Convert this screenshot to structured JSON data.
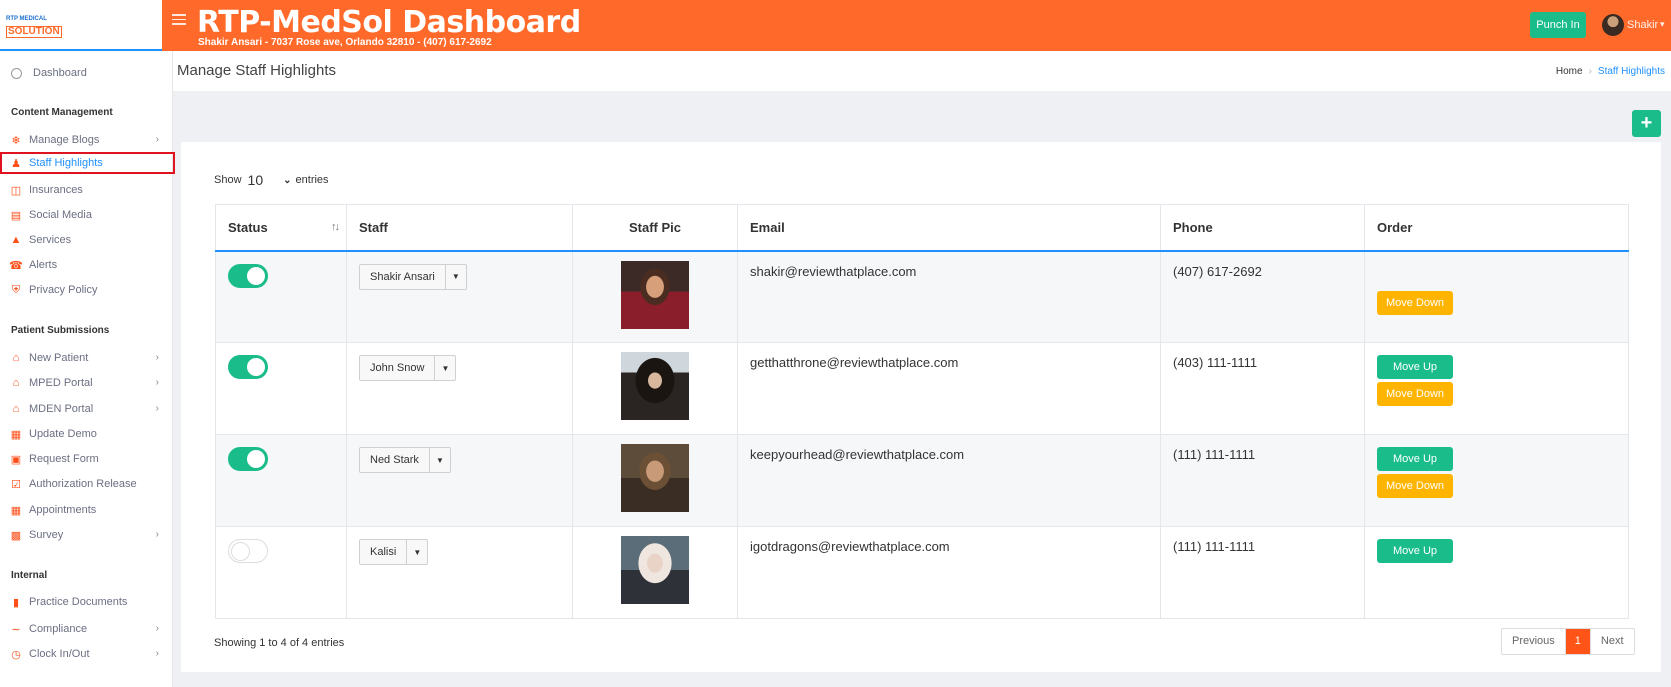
{
  "header": {
    "logo_top": "RTP MEDICAL",
    "logo_main": "SOLUTION",
    "title": "RTP-MedSol Dashboard",
    "subtitle": "Shakir Ansari - 7037 Rose ave, Orlando 32810 - (407) 617-2692",
    "punch_in": "Punch In",
    "user_name": "Shakir",
    "accent_color": "#ff6a2b"
  },
  "sidebar": {
    "dashboard": "Dashboard",
    "sections": {
      "content": "Content Management",
      "patient": "Patient Submissions",
      "internal": "Internal"
    },
    "items": [
      {
        "label": "Manage Blogs",
        "icon": "blog-icon"
      },
      {
        "label": "Staff Highlights",
        "icon": "user-badge-icon"
      },
      {
        "label": "Insurances",
        "icon": "insurance-icon"
      },
      {
        "label": "Social Media",
        "icon": "social-icon"
      },
      {
        "label": "Services",
        "icon": "services-icon"
      },
      {
        "label": "Alerts",
        "icon": "phone-icon"
      },
      {
        "label": "Privacy Policy",
        "icon": "shield-icon"
      },
      {
        "label": "New Patient",
        "icon": "home-icon"
      },
      {
        "label": "MPED Portal",
        "icon": "home-icon"
      },
      {
        "label": "MDEN Portal",
        "icon": "home-icon"
      },
      {
        "label": "Update Demo",
        "icon": "id-card-icon"
      },
      {
        "label": "Request Form",
        "icon": "form-icon"
      },
      {
        "label": "Authorization Release",
        "icon": "check-doc-icon"
      },
      {
        "label": "Appointments",
        "icon": "calendar-icon"
      },
      {
        "label": "Survey",
        "icon": "chart-icon"
      },
      {
        "label": "Practice Documents",
        "icon": "clipboard-icon"
      },
      {
        "label": "Compliance",
        "icon": "signature-icon"
      },
      {
        "label": "Clock In/Out",
        "icon": "clock-icon"
      }
    ]
  },
  "page": {
    "title": "Manage Staff Highlights",
    "breadcrumb_home": "Home",
    "breadcrumb_current": "Staff Highlights"
  },
  "table": {
    "show_label": "Show",
    "entries_value": "10",
    "entries_label": "entries",
    "columns": [
      "Status",
      "Staff",
      "Staff Pic",
      "Email",
      "Phone",
      "Order"
    ],
    "rows": [
      {
        "active": true,
        "name": "Shakir Ansari",
        "email": "shakir@reviewthatplace.com",
        "phone": "(407) 617-2692"
      },
      {
        "active": true,
        "name": "John Snow",
        "email": "getthatthrone@reviewthatplace.com",
        "phone": "(403) 111-1111"
      },
      {
        "active": true,
        "name": "Ned Stark",
        "email": "keepyourhead@reviewthatplace.com",
        "phone": "(111) 111-1111"
      },
      {
        "active": false,
        "name": "Kalisi",
        "email": "igotdragons@reviewthatplace.com",
        "phone": "(111) 111-1111"
      }
    ],
    "move_up": "Move Up",
    "move_down": "Move Down",
    "showing": "Showing 1 to 4 of 4 entries",
    "previous": "Previous",
    "page": "1",
    "next": "Next"
  }
}
